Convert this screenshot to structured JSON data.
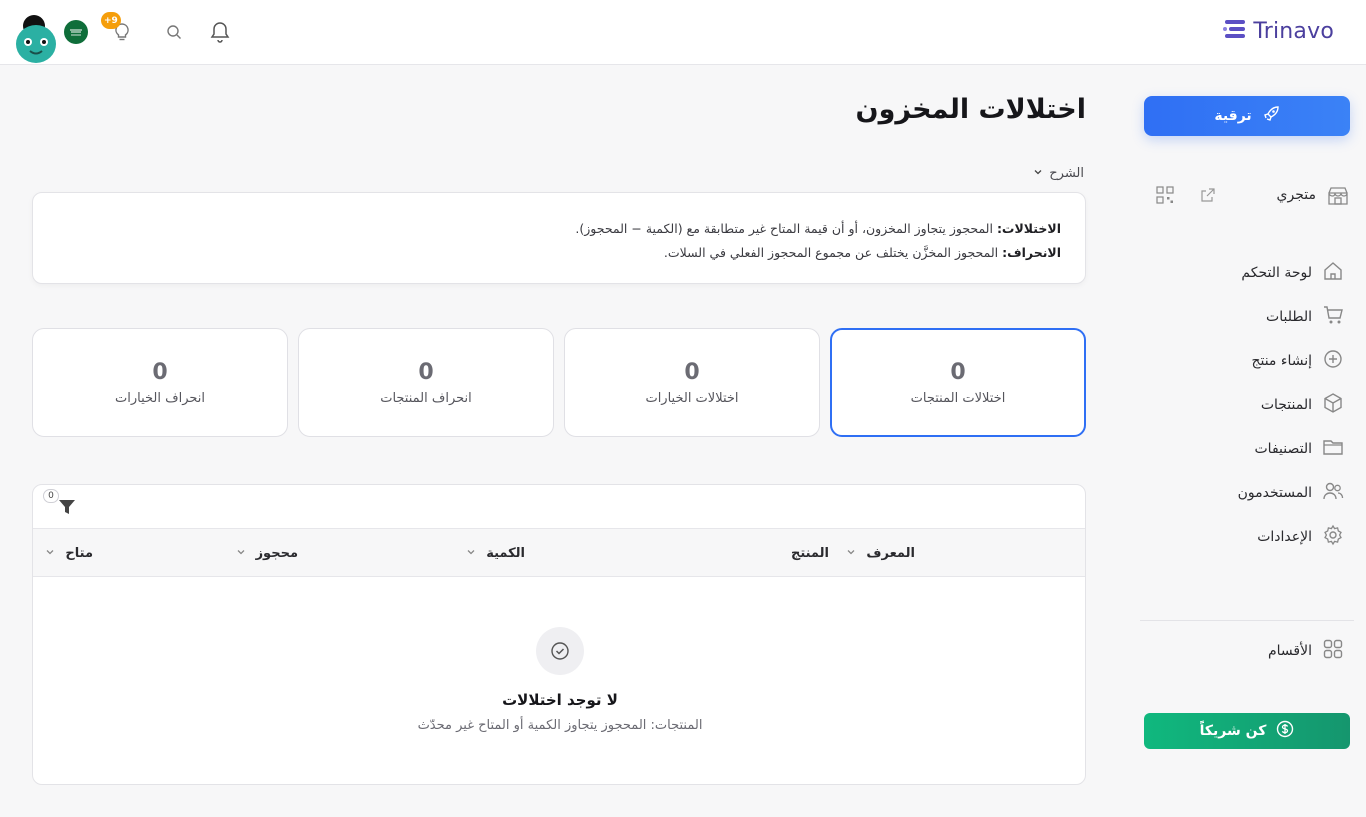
{
  "header": {
    "brand": "Trinavo",
    "badge_count": "+9",
    "colors": {
      "brand": "#4b3f9e",
      "badge": "#f59e0b"
    }
  },
  "sidebar": {
    "upgrade_label": "ترقية",
    "store_label": "متجري",
    "items": [
      {
        "label": "لوحة التحكم",
        "icon": "home-icon"
      },
      {
        "label": "الطلبات",
        "icon": "cart-icon"
      },
      {
        "label": "إنشاء منتج",
        "icon": "plus-circle-icon"
      },
      {
        "label": "المنتجات",
        "icon": "box-icon"
      },
      {
        "label": "التصنيفات",
        "icon": "folder-icon"
      },
      {
        "label": "المستخدمون",
        "icon": "users-icon"
      },
      {
        "label": "الإعدادات",
        "icon": "gear-icon"
      }
    ],
    "sections_label": "الأقسام",
    "partner_label": "كن شريكاً",
    "colors": {
      "upgrade": "#2f6ff4",
      "partner": "#10b87e"
    }
  },
  "main": {
    "title": "اختلالات المخزون",
    "explain_toggle": "الشرح",
    "explain": {
      "line1_term": "الاختلالات:",
      "line1_text": " المحجوز يتجاوز المخزون، أو أن قيمة المتاح غير متطابقة مع (الكمية − المحجوز).",
      "line2_term": "الانحراف:",
      "line2_text": " المحجوز المخزَّن يختلف عن مجموع المحجوز الفعلي في السلات."
    },
    "stats": [
      {
        "value": "0",
        "label": "اختلالات المنتجات",
        "active": true
      },
      {
        "value": "0",
        "label": "اختلالات الخيارات",
        "active": false
      },
      {
        "value": "0",
        "label": "انحراف المنتجات",
        "active": false
      },
      {
        "value": "0",
        "label": "انحراف الخيارات",
        "active": false
      }
    ],
    "table": {
      "filter_count": "0",
      "columns": [
        "المعرف",
        "المنتج",
        "الكمية",
        "محجوز",
        "متاح"
      ],
      "empty_title": "لا توجد اختلالات",
      "empty_subtitle": "المنتجات: المحجوز يتجاوز الكمية أو المتاح غير محدّث"
    }
  }
}
